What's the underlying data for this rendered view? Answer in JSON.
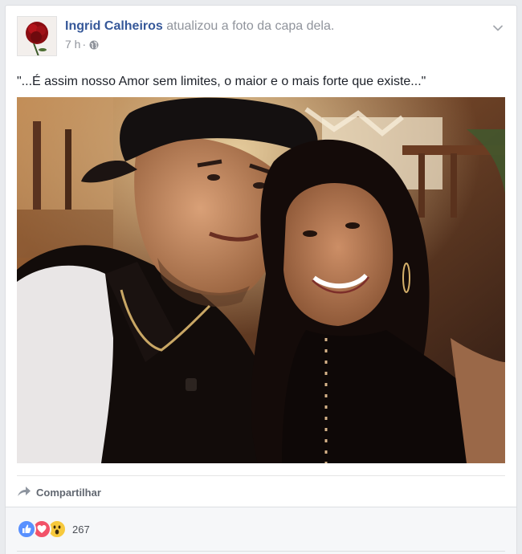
{
  "post": {
    "author": "Ingrid Calheiros",
    "action": "atualizou a foto da capa dela.",
    "time": "7 h",
    "separator": "·",
    "privacy_icon": "globe-icon",
    "caption": "\"...É assim nosso Amor sem limites, o maior e o mais forte que existe...\""
  },
  "actions": {
    "share_label": "Compartilhar"
  },
  "reactions": {
    "icons": [
      "like-reaction-icon",
      "love-reaction-icon",
      "wow-reaction-icon"
    ],
    "count": "267"
  },
  "colors": {
    "author_link": "#365899",
    "secondary_text": "#90949c",
    "like": "#5890ff",
    "love": "#f25268",
    "wow": "#f7c93d"
  }
}
